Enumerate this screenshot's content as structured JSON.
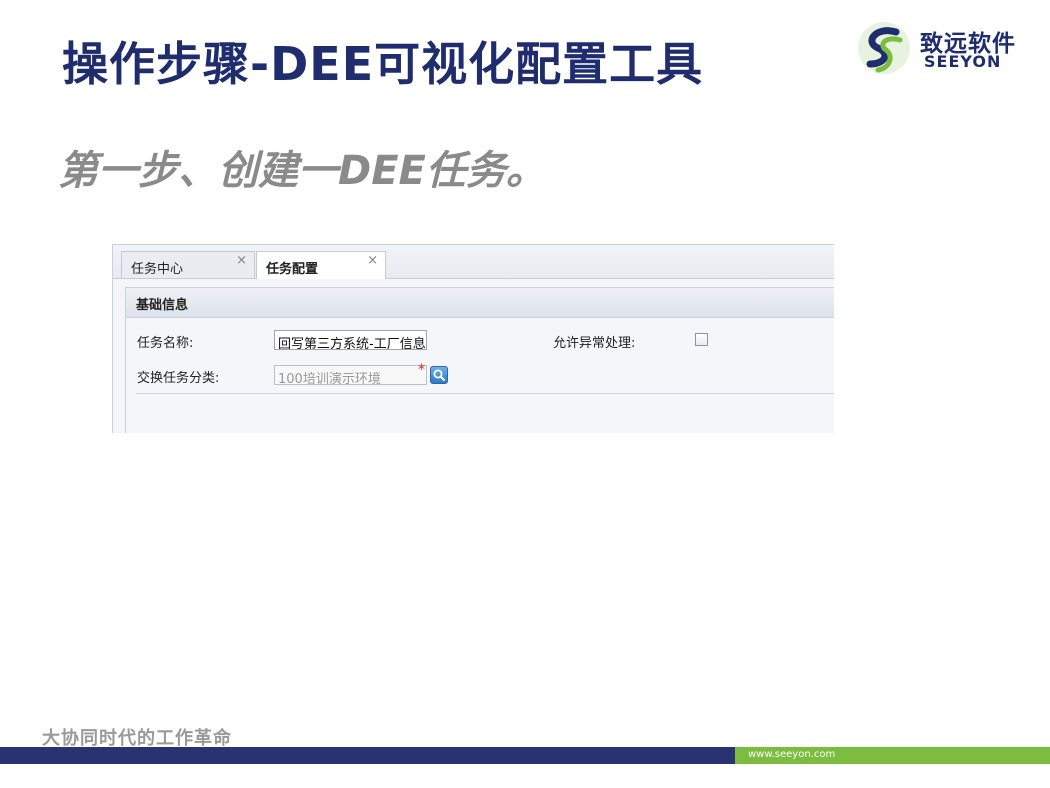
{
  "slide": {
    "title": "操作步骤-DEE可视化配置工具",
    "step_heading": "第一步、创建一DEE任务。",
    "slogan": "大协同时代的工作革命",
    "footer_url": "www.seeyon.com"
  },
  "logo": {
    "cn": "致远软件",
    "en": "SEEYON"
  },
  "tabs": [
    {
      "label": "任务中心",
      "close": "×"
    },
    {
      "label": "任务配置",
      "close": "×"
    }
  ],
  "form": {
    "section_title": "基础信息",
    "task_name_label": "任务名称:",
    "task_name_value": "回写第三方系统-工厂信息",
    "exchange_category_label": "交换任务分类:",
    "exchange_category_value": "100培训演示环境",
    "required_mark": "*",
    "allow_exception_label": "允许异常处理:"
  },
  "colors": {
    "title": "#1f2d6e",
    "heading_gray": "#8a8a8a",
    "footer_navy": "#2a3372",
    "footer_green": "#7cbc3f"
  }
}
